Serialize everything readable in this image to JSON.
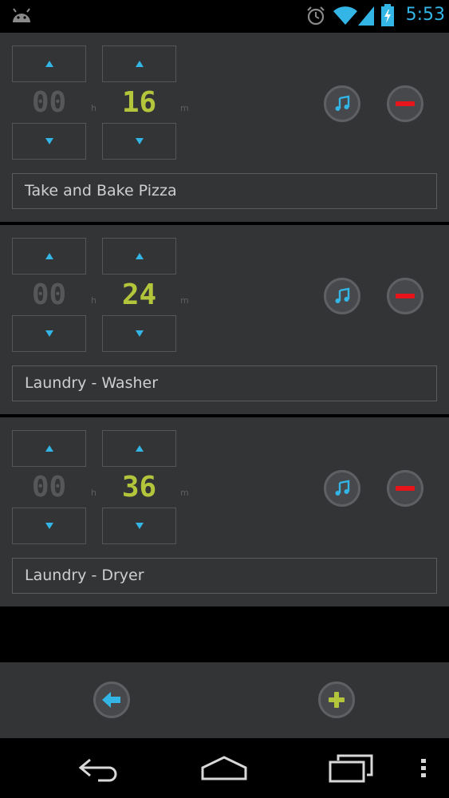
{
  "status_bar": {
    "time": "5:53",
    "icons": [
      "android-icon",
      "alarm-icon",
      "wifi-icon",
      "signal-icon",
      "battery-charging-icon"
    ]
  },
  "timers": [
    {
      "hours": "00",
      "minutes": "16",
      "hour_unit": "h",
      "minute_unit": "m",
      "name": "Take and Bake Pizza"
    },
    {
      "hours": "00",
      "minutes": "24",
      "hour_unit": "h",
      "minute_unit": "m",
      "name": "Laundry - Washer"
    },
    {
      "hours": "00",
      "minutes": "36",
      "hour_unit": "h",
      "minute_unit": "m",
      "name": "Laundry - Dryer"
    }
  ],
  "controls": {
    "increment_icon": "triangle-up-icon",
    "decrement_icon": "triangle-down-icon",
    "sound_icon": "music-note-icon",
    "remove_icon": "minus-icon"
  },
  "bottom_bar": {
    "back_icon": "arrow-left-icon",
    "add_icon": "plus-icon"
  },
  "nav_bar": {
    "icons": [
      "back-icon",
      "home-icon",
      "recent-apps-icon",
      "overflow-menu-icon"
    ]
  },
  "colors": {
    "accent_blue": "#33b5e5",
    "minutes_green": "#b3c63b",
    "hours_gray": "#555759",
    "remove_red": "#e8141b",
    "card_bg": "#333436"
  }
}
